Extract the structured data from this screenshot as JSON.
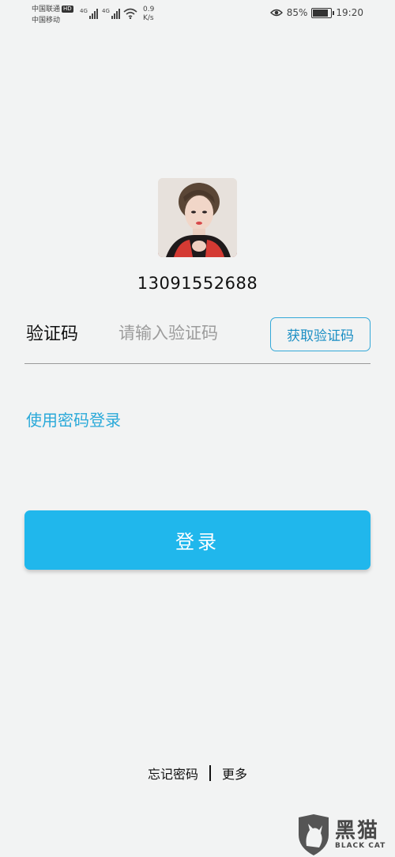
{
  "status_bar": {
    "carrier_1": "中国联通",
    "hd_badge": "HD",
    "carrier_2": "中国移动",
    "network_1": "4G",
    "network_2": "4G",
    "net_speed_value": "0.9",
    "net_speed_unit": "K/s",
    "battery_percent": "85%",
    "battery_level": 0.85,
    "time": "19:20"
  },
  "account": {
    "phone": "13091552688"
  },
  "verification": {
    "label": "验证码",
    "placeholder": "请输入验证码",
    "get_code_label": "获取验证码"
  },
  "links": {
    "password_login": "使用密码登录",
    "forgot_password": "忘记密码",
    "more": "更多"
  },
  "actions": {
    "login_label": "登录"
  },
  "watermark": {
    "cn": "黑猫",
    "en": "BLACK CAT"
  },
  "colors": {
    "accent": "#20b7ec",
    "link": "#2aa9d9",
    "background": "#f2f3f3"
  }
}
